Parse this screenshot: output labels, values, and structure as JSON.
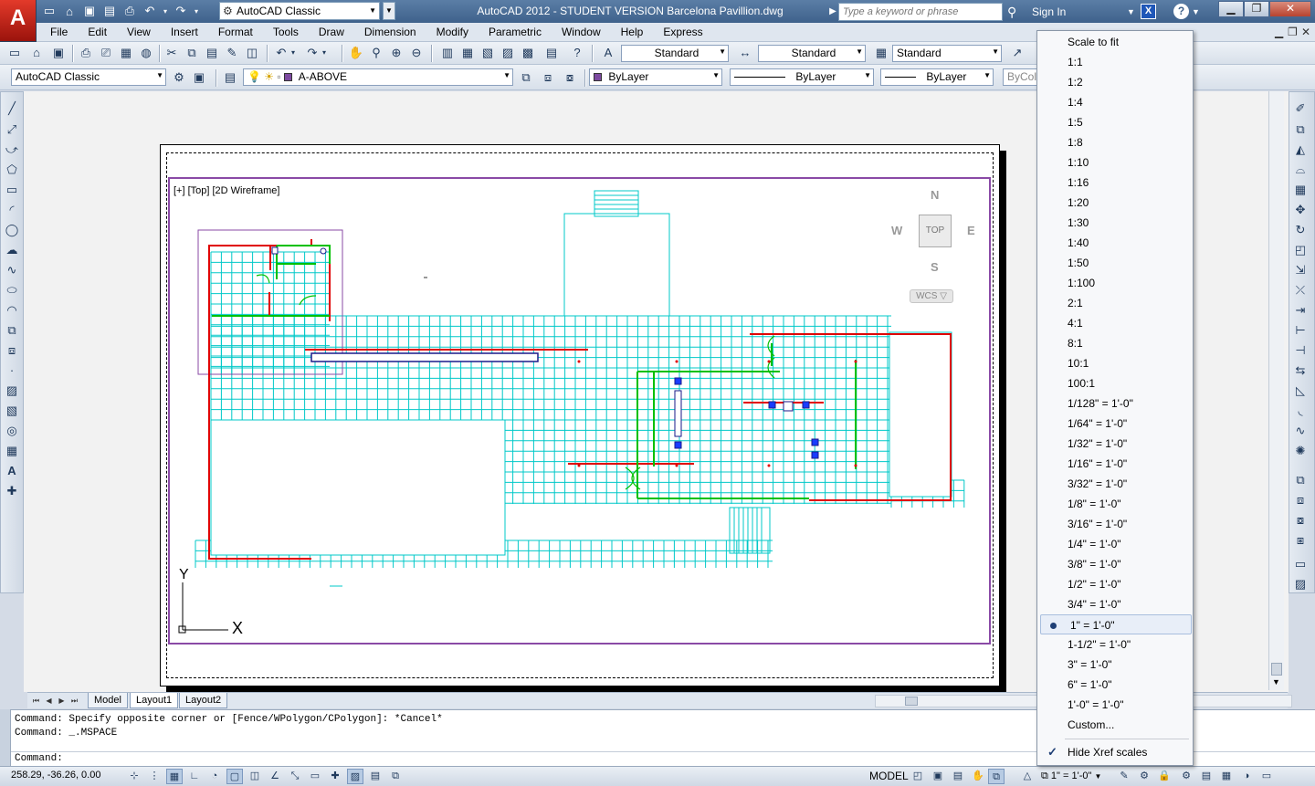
{
  "titlebar": {
    "workspace": "AutoCAD Classic",
    "title": "AutoCAD 2012 - STUDENT VERSION    Barcelona Pavillion.dwg",
    "search_placeholder": "Type a keyword or phrase",
    "sign_in": "Sign In",
    "exchange_label": "X",
    "help_label": "?"
  },
  "menus": [
    "File",
    "Edit",
    "View",
    "Insert",
    "Format",
    "Tools",
    "Draw",
    "Dimension",
    "Modify",
    "Parametric",
    "Window",
    "Help",
    "Express"
  ],
  "toolbar_styles": {
    "text_style": "Standard",
    "dim_style": "Standard",
    "table_style": "Standard"
  },
  "toolbar_layers": {
    "workspace": "AutoCAD Classic",
    "layer": "A-ABOVE",
    "color": "ByLayer",
    "linetype": "ByLayer",
    "lineweight": "ByLayer",
    "plotstyle": "ByColor"
  },
  "viewport": {
    "label": "[+] [Top] [2D Wireframe]",
    "compass": {
      "n": "N",
      "s": "S",
      "e": "E",
      "w": "W",
      "cube": "TOP"
    },
    "wcs": "WCS ▽",
    "ucs_x": "X",
    "ucs_y": "Y"
  },
  "layout_tabs": [
    "Model",
    "Layout1",
    "Layout2"
  ],
  "command_history": [
    "Command: Specify opposite corner or [Fence/WPolygon/CPolygon]: *Cancel*",
    "Command: _.MSPACE"
  ],
  "command_prompt": "Command:",
  "status": {
    "coords": "258.29, -36.26, 0.00",
    "space": "MODEL",
    "annotation_scale": "1\" = 1'-0\""
  },
  "scale_menu": {
    "items": [
      "Scale to fit",
      "1:1",
      "1:2",
      "1:4",
      "1:5",
      "1:8",
      "1:10",
      "1:16",
      "1:20",
      "1:30",
      "1:40",
      "1:50",
      "1:100",
      "2:1",
      "4:1",
      "8:1",
      "10:1",
      "100:1",
      "1/128\" = 1'-0\"",
      "1/64\" = 1'-0\"",
      "1/32\" = 1'-0\"",
      "1/16\" = 1'-0\"",
      "3/32\" = 1'-0\"",
      "1/8\" = 1'-0\"",
      "3/16\" = 1'-0\"",
      "1/4\" = 1'-0\"",
      "3/8\" = 1'-0\"",
      "1/2\" = 1'-0\"",
      "3/4\" = 1'-0\"",
      "1\" = 1'-0\"",
      "1-1/2\" = 1'-0\"",
      "3\" = 1'-0\"",
      "6\" = 1'-0\"",
      "1'-0\" = 1'-0\"",
      "Custom..."
    ],
    "selected": "1\" = 1'-0\"",
    "hide_xref": "Hide Xref scales"
  },
  "colors": {
    "grid": "#00c8c8",
    "wall": "#e00000",
    "green": "#00c000",
    "viewport_border": "#8a4aa6"
  }
}
